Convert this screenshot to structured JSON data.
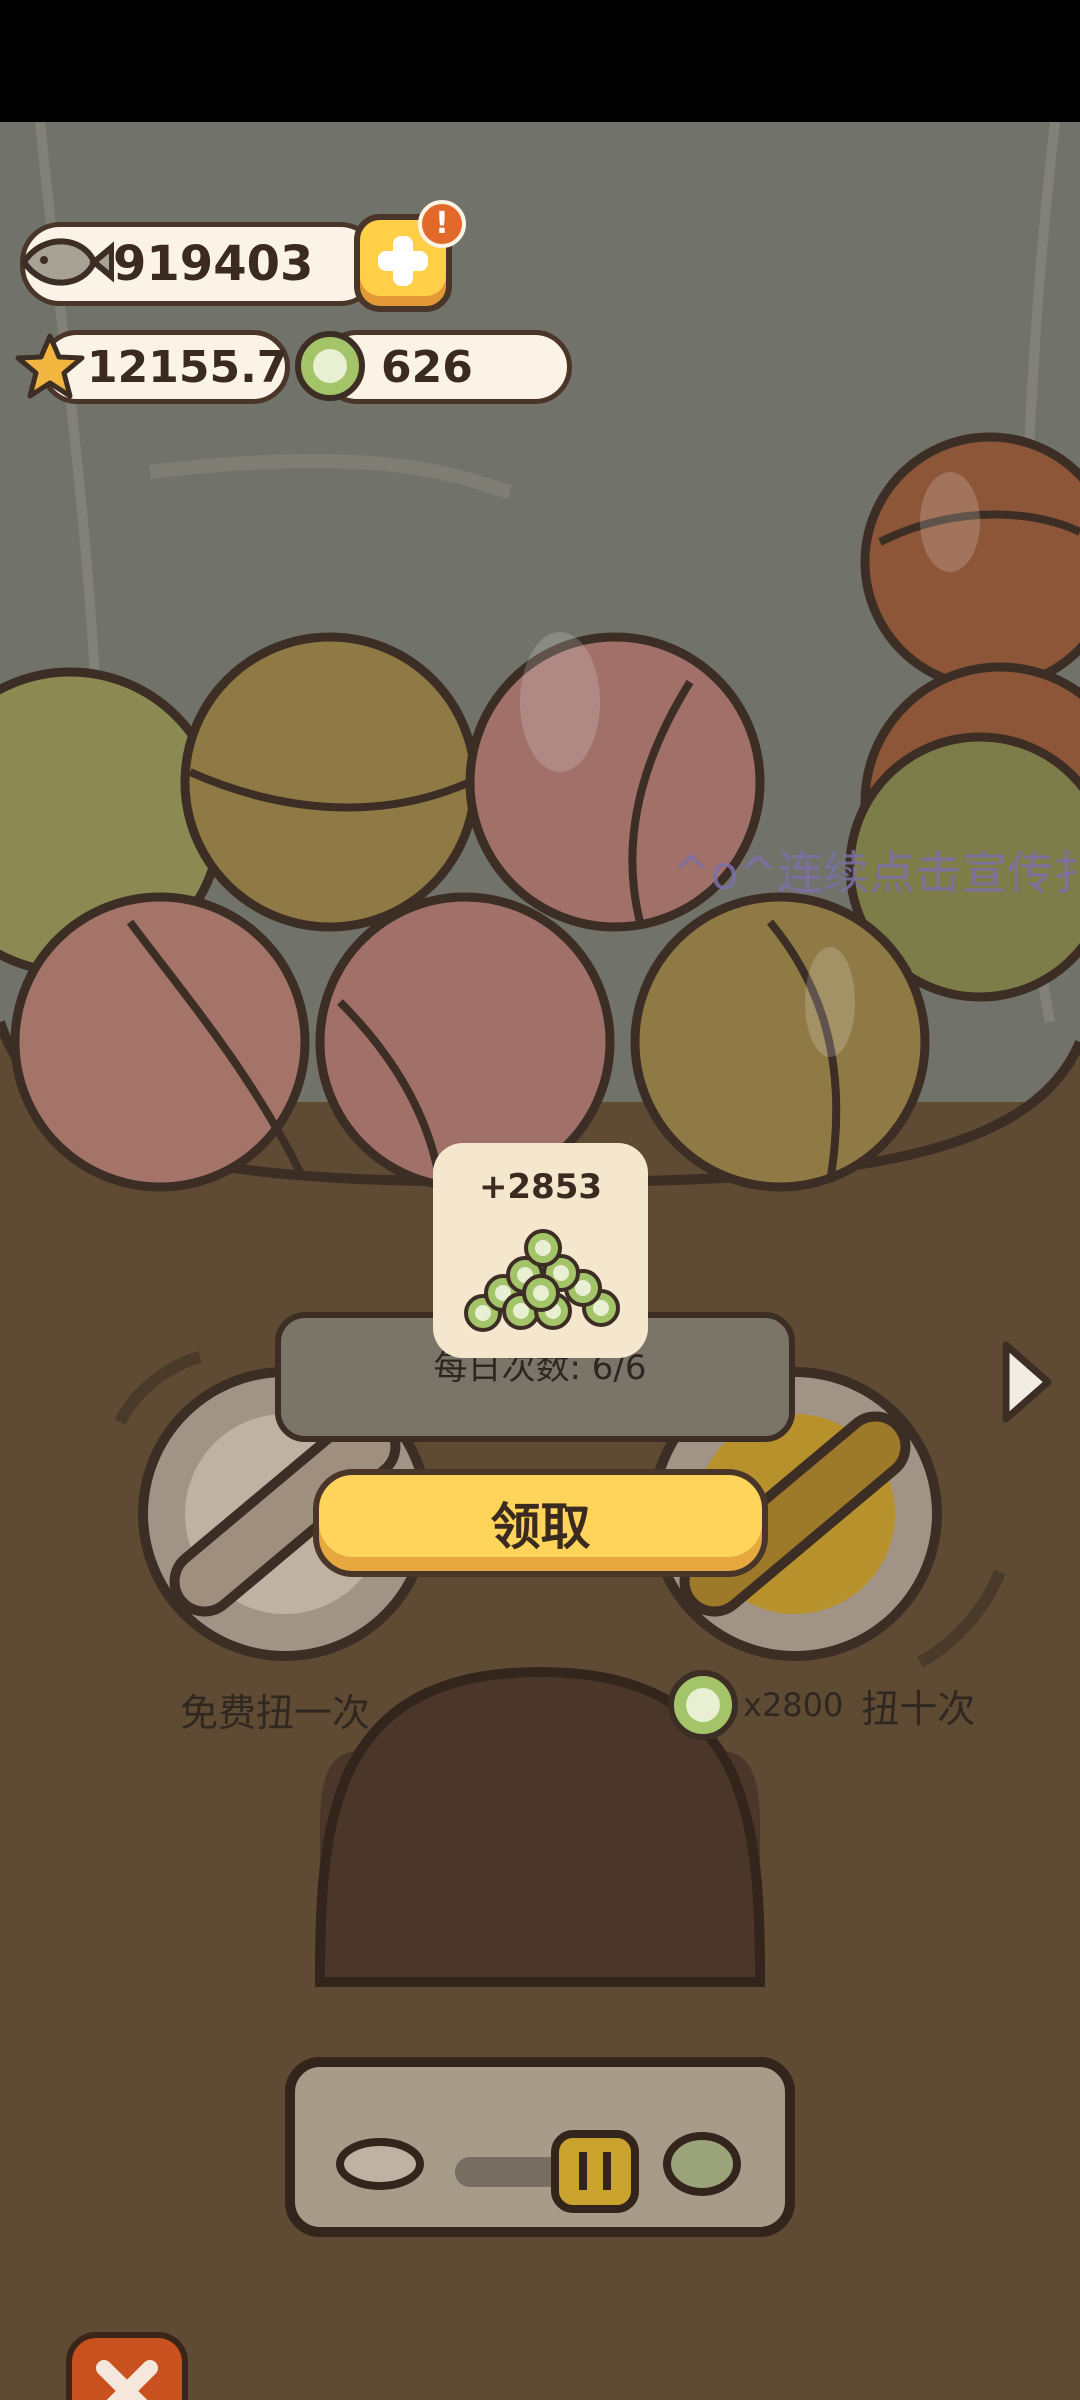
{
  "currencies": {
    "fish": "919403",
    "star": "12155.7",
    "coin": "626"
  },
  "banner_text": "^o^连续点击宣传扌",
  "reward": {
    "amount": "+2853"
  },
  "daily_count": "每日次数: 6/6",
  "claim_button": "领取",
  "free_spin_label": "免费扭一次",
  "ten_spin": {
    "cost": "x2800",
    "label": "扭十次"
  },
  "icons": {
    "fish": "fish-icon",
    "star": "star-icon",
    "coin": "coin-icon",
    "add": "plus-icon",
    "alert": "exclamation-icon",
    "next": "chevron-right-icon",
    "close": "close-icon"
  },
  "colors": {
    "background": "#5f4b34",
    "claim_button": "#ffd45a",
    "close_button": "#c9501f",
    "alert_badge": "#e2692a"
  }
}
